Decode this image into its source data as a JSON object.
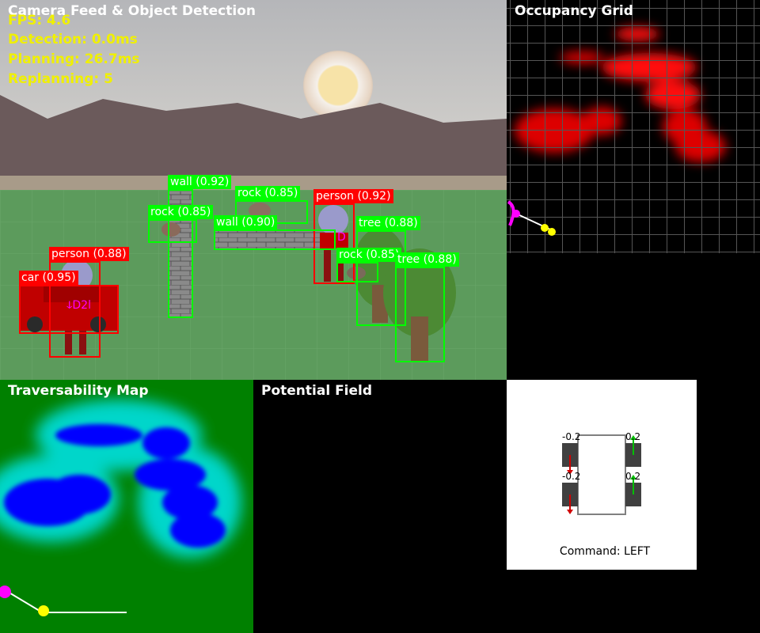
{
  "camera": {
    "title": "Camera Feed & Object Detection",
    "stats": {
      "fps": "FPS: 4.6",
      "detection": "Detection: 0.0ms",
      "planning": "Planning: 26.7ms",
      "replanning": "Replanning: 5"
    },
    "detections": [
      {
        "label": "wall (0.92)",
        "color": "#00ff00"
      },
      {
        "label": "rock (0.85)",
        "color": "#00ff00"
      },
      {
        "label": "person (0.92)",
        "color": "#ff0000"
      },
      {
        "label": "rock (0.85)",
        "color": "#00ff00"
      },
      {
        "label": "wall (0.90)",
        "color": "#00ff00"
      },
      {
        "label": "tree (0.88)",
        "color": "#00ff00"
      },
      {
        "label": "person (0.88)",
        "color": "#ff0000"
      },
      {
        "label": "rock (0.85)",
        "color": "#00ff00"
      },
      {
        "label": "tree (0.88)",
        "color": "#00ff00"
      },
      {
        "label": "car (0.95)",
        "color": "#ff0000"
      }
    ]
  },
  "occupancy": {
    "title": "Occupancy Grid"
  },
  "traversability": {
    "title": "Traversability Map"
  },
  "potential": {
    "title": "Potential Field"
  },
  "robot": {
    "wheel_values": [
      "-0.2",
      "0.2",
      "-0.2",
      "0.2"
    ],
    "command": "Command: LEFT"
  },
  "colors": {
    "sky": "#c8c8cc",
    "mountains": "#6b5a5a",
    "ground": "#5a9a5a",
    "grid_bg": "#000000",
    "trav_bg": "#008000",
    "trav_obstacle": "#0000ff",
    "text_stats": "#f0f000",
    "path": "#ffffff",
    "robot_marker": "#ff00ff",
    "goal_marker": "#ffff00"
  }
}
